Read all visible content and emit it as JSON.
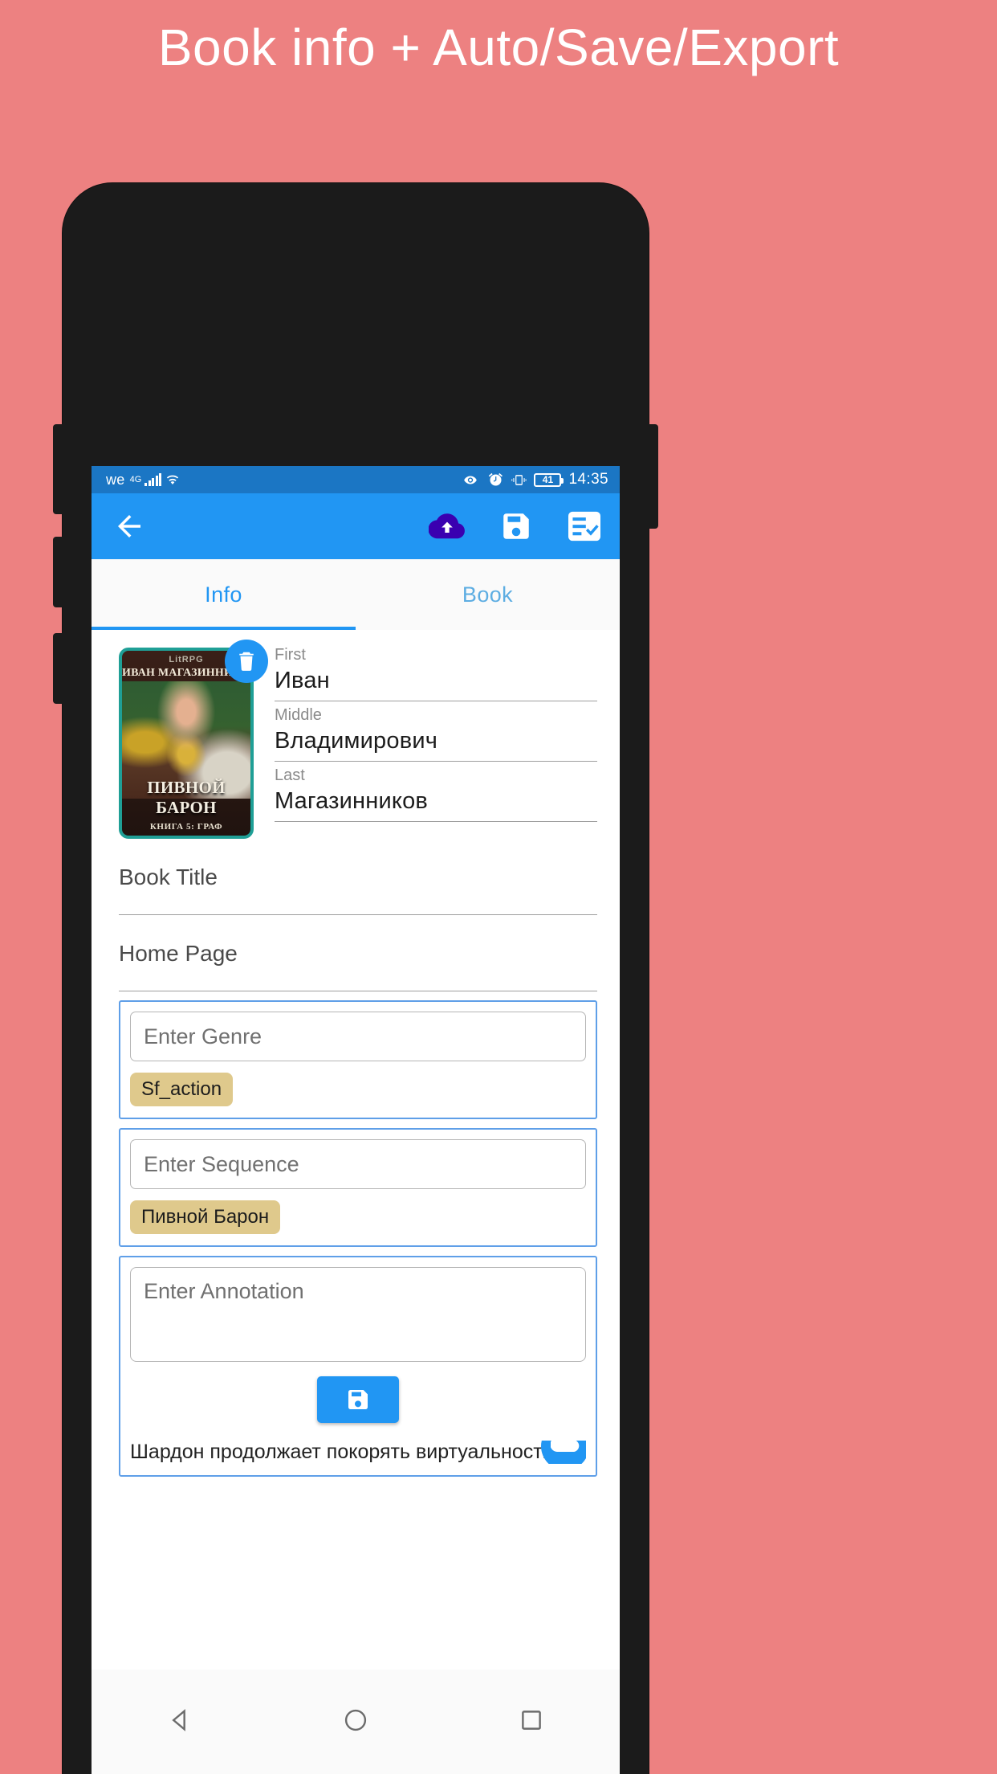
{
  "headline": "Book info + Auto/Save/Export",
  "statusbar": {
    "carrier": "we",
    "network": "4G",
    "signal_icon": "signal-bars-icon",
    "wifi_icon": "wifi-icon",
    "eye_icon": "eye-icon",
    "alarm_icon": "alarm-clock-icon",
    "vibrate_icon": "vibrate-icon",
    "battery_level": "41",
    "time": "14:35",
    "bg_color": "#1b76c4"
  },
  "toolbar": {
    "back_icon": "arrow-back-icon",
    "cloud_upload_icon": "cloud-upload-icon",
    "save_icon": "floppy-save-icon",
    "export_icon": "playlist-check-icon",
    "bg_color": "#2196f3",
    "cloud_color": "#3a00b0"
  },
  "tabs": [
    {
      "label": "Info",
      "active": true
    },
    {
      "label": "Book",
      "active": false
    }
  ],
  "cover": {
    "badge_label": "LitRPG",
    "author_line": "ИВАН МАГАЗИННИКОВ",
    "title_line": "ПИВНОЙ БАРОН",
    "subtitle_line": "КНИГА 5: ГРАФ",
    "delete_icon": "trash-icon",
    "border_color": "#1f9f96"
  },
  "author": {
    "fields": [
      {
        "label": "First",
        "value": "Иван"
      },
      {
        "label": "Middle",
        "value": "Владимирович"
      },
      {
        "label": "Last",
        "value": "Магазинников"
      }
    ]
  },
  "book": {
    "title_placeholder": "Book Title",
    "homepage_placeholder": "Home Page"
  },
  "genre": {
    "input_placeholder": "Enter Genre",
    "chips": [
      "Sf_action"
    ]
  },
  "sequence": {
    "input_placeholder": "Enter Sequence",
    "chips": [
      "Пивной Барон"
    ]
  },
  "annotation": {
    "input_placeholder": "Enter Annotation",
    "save_icon": "floppy-save-icon",
    "text": "Шардон продолжает покорять виртуальность. И",
    "fab_icon": "cloud-upload-icon"
  },
  "navbar": {
    "back_icon": "nav-back-triangle-icon",
    "home_icon": "nav-home-circle-icon",
    "recents_icon": "nav-recents-square-icon"
  },
  "colors": {
    "page_bg": "#ed8181",
    "accent": "#2196f3",
    "chip": "#dfc98c",
    "card_border": "#5f9fe8"
  }
}
